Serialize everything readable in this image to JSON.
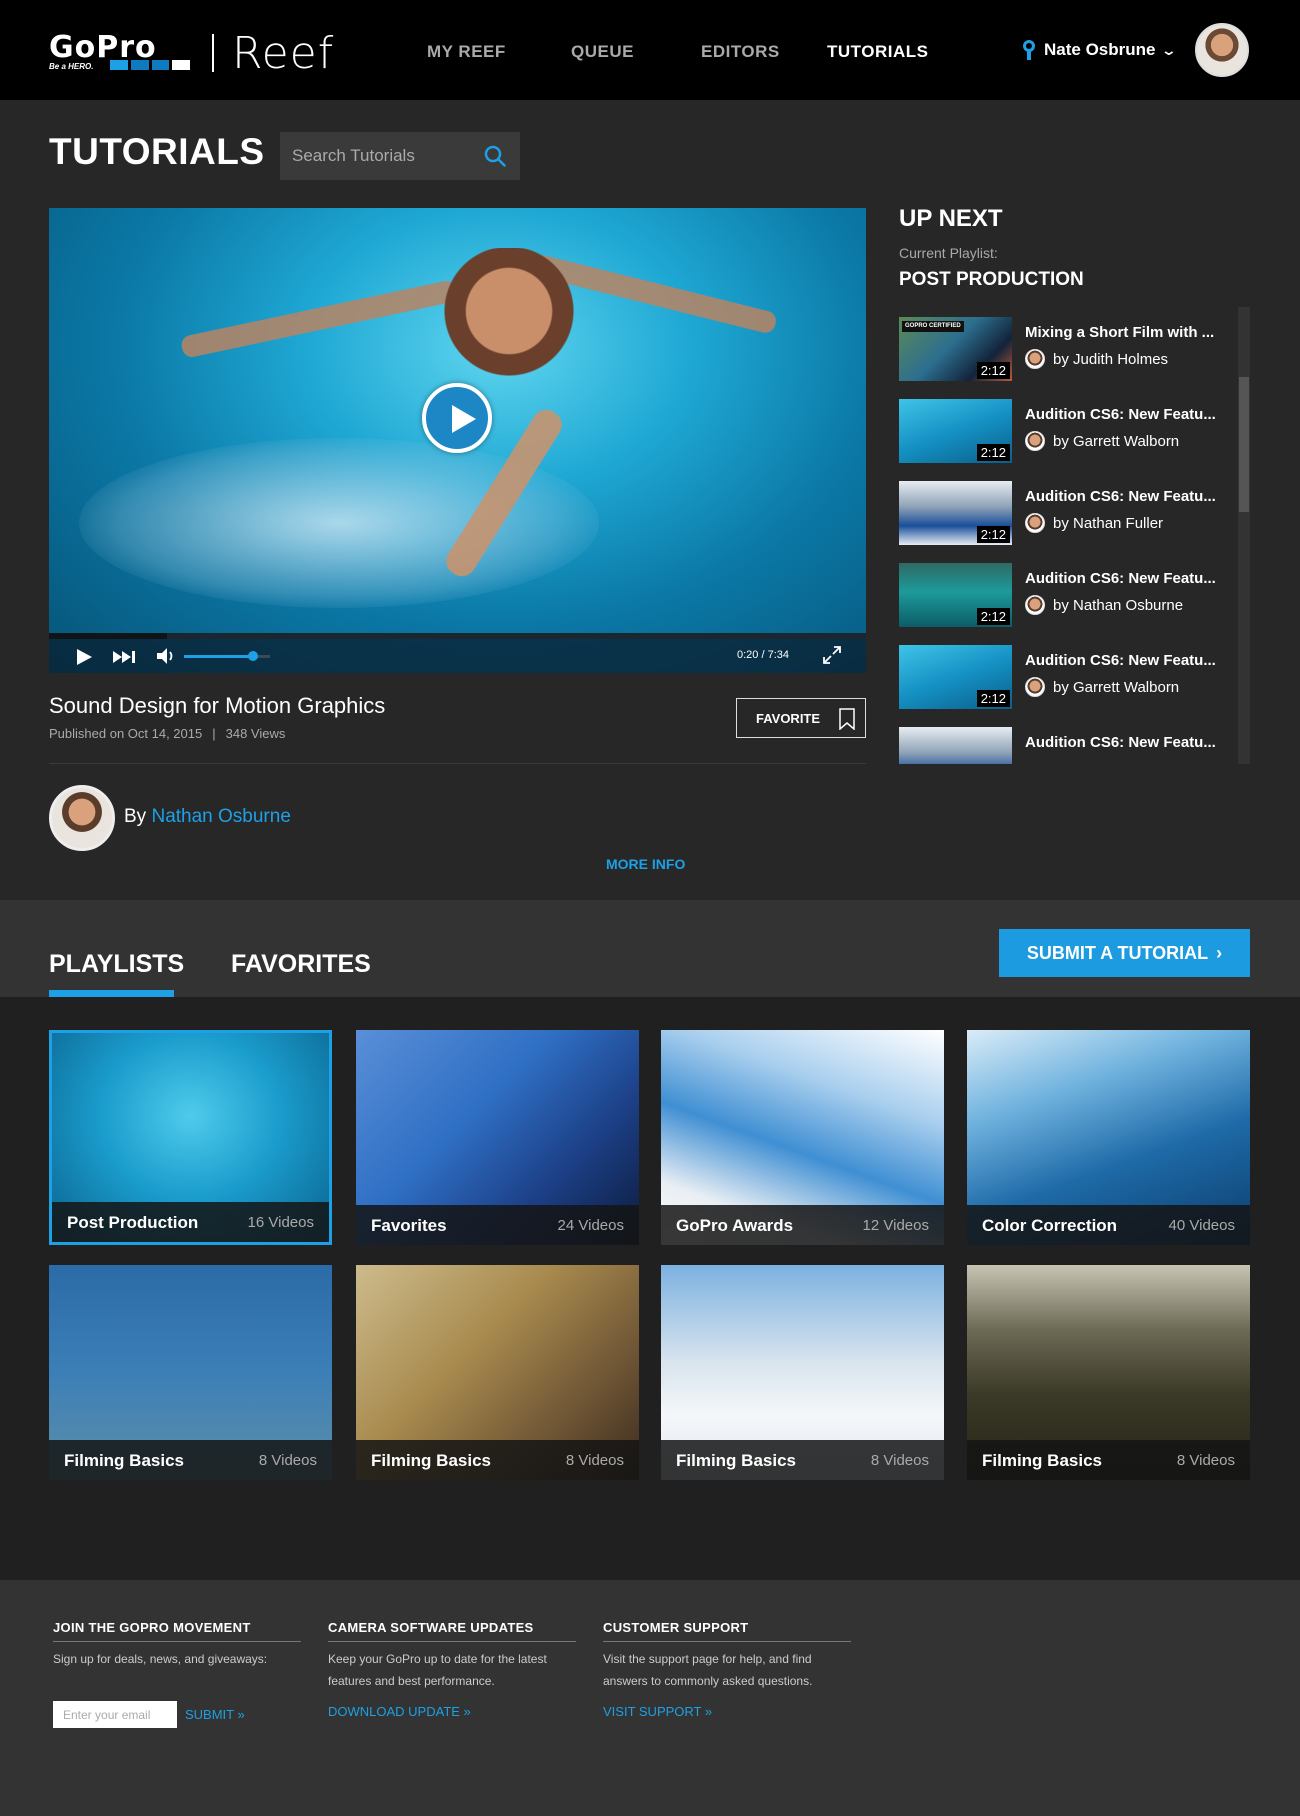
{
  "header": {
    "logo_text": "GoPro",
    "logo_tagline": "Be a HERO.",
    "product_name": "Reef",
    "nav": [
      "MY REEF",
      "QUEUE",
      "EDITORS",
      "TUTORIALS"
    ],
    "active_nav": "TUTORIALS",
    "user_name": "Nate Osbrune"
  },
  "page": {
    "title": "TUTORIALS",
    "search_placeholder": "Search Tutorials"
  },
  "video": {
    "title": "Sound Design for Motion Graphics",
    "published": "Published on Oct 14, 2015",
    "separator": "|",
    "views": "348 Views",
    "time": "0:20 / 7:34",
    "progress_fraction": 0.045,
    "volume_fraction": 0.8,
    "favorite_label": "FAVORITE",
    "author_prefix": "By",
    "author_name": "Nathan Osburne",
    "more_info": "MORE INFO"
  },
  "up_next": {
    "title": "UP NEXT",
    "current_playlist_label": "Current Playlist:",
    "playlist_name": "POST PRODUCTION",
    "items": [
      {
        "title": "Mixing a Short Film with ...",
        "author": "by Judith Holmes",
        "duration": "2:12",
        "badge": "GOPRO CERTIFIED"
      },
      {
        "title": "Audition CS6: New Featu...",
        "author": "by Garrett Walborn",
        "duration": "2:12"
      },
      {
        "title": "Audition CS6: New Featu...",
        "author": "by Nathan Fuller",
        "duration": "2:12"
      },
      {
        "title": "Audition CS6: New Featu...",
        "author": "by Nathan Osburne",
        "duration": "2:12"
      },
      {
        "title": "Audition CS6: New Featu...",
        "author": "by Garrett Walborn",
        "duration": "2:12"
      },
      {
        "title": "Audition CS6: New Featu...",
        "author": "",
        "duration": ""
      }
    ]
  },
  "library": {
    "tabs": [
      "PLAYLISTS",
      "FAVORITES"
    ],
    "active_tab": "PLAYLISTS",
    "submit_label": "SUBMIT A TUTORIAL",
    "playlists": [
      {
        "name": "Post Production",
        "count": "16 Videos",
        "selected": true
      },
      {
        "name": "Favorites",
        "count": "24 Videos"
      },
      {
        "name": "GoPro Awards",
        "count": "12 Videos"
      },
      {
        "name": "Color Correction",
        "count": "40 Videos"
      },
      {
        "name": "Filming Basics",
        "count": "8 Videos"
      },
      {
        "name": "Filming Basics",
        "count": "8 Videos"
      },
      {
        "name": "Filming Basics",
        "count": "8 Videos"
      },
      {
        "name": "Filming Basics",
        "count": "8 Videos"
      }
    ]
  },
  "footer": {
    "join": {
      "title": "JOIN THE GOPRO MOVEMENT",
      "text": "Sign up for deals, news, and giveaways:",
      "email_placeholder": "Enter your email",
      "submit": "SUBMIT »"
    },
    "updates": {
      "title": "CAMERA SOFTWARE UPDATES",
      "text": "Keep your GoPro up to date for the latest features and best performance.",
      "link": "DOWNLOAD UPDATE »"
    },
    "support": {
      "title": "CUSTOMER SUPPORT",
      "text": "Visit the support page for help, and find answers to commonly asked questions.",
      "link": "VISIT SUPPORT »"
    }
  },
  "colors": {
    "accent": "#1da0e6",
    "header_bg": "#000000",
    "page_bg": "#272727",
    "band_bg": "#333333"
  }
}
